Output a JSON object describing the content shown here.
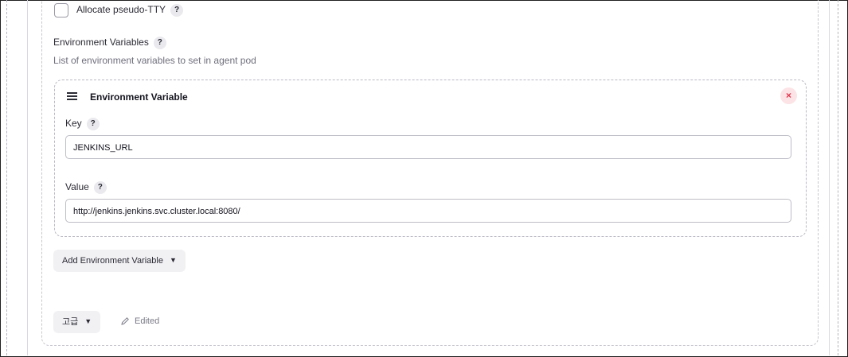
{
  "pseudo_tty": {
    "label": "Allocate pseudo-TTY",
    "help": "?",
    "checked": false
  },
  "env_section": {
    "title": "Environment Variables",
    "help": "?",
    "description": "List of environment variables to set in agent pod"
  },
  "env_variable": {
    "title": "Environment Variable",
    "close": "×",
    "key_label": "Key",
    "key_help": "?",
    "key_value": "JENKINS_URL",
    "value_label": "Value",
    "value_help": "?",
    "value_value": "http://jenkins.jenkins.svc.cluster.local:8080/"
  },
  "add_button": {
    "label": "Add Environment Variable"
  },
  "advanced_button": {
    "label": "고급"
  },
  "edited": {
    "label": "Edited"
  },
  "icons": {
    "drag": "drag-handle-icon",
    "close": "close-icon",
    "chevron": "chevron-down-icon",
    "pencil": "pencil-icon"
  }
}
